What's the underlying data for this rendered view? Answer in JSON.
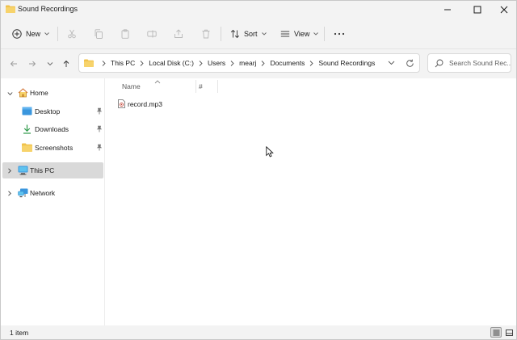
{
  "window": {
    "title": "Sound Recordings",
    "accent_color": "#0067c0",
    "folder_color": "#f0c24b"
  },
  "toolbar": {
    "new_label": "New",
    "sort_label": "Sort",
    "view_label": "View"
  },
  "address": {
    "crumbs": [
      "This PC",
      "Local Disk (C:)",
      "Users",
      "mearj",
      "Documents",
      "Sound Recordings"
    ]
  },
  "search": {
    "placeholder": "Search Sound Rec..."
  },
  "sidebar": {
    "items": [
      {
        "label": "Home",
        "icon": "home-icon",
        "expanded": true
      },
      {
        "label": "Desktop",
        "icon": "desktop-icon",
        "pinned": true
      },
      {
        "label": "Downloads",
        "icon": "downloads-icon",
        "pinned": true
      },
      {
        "label": "Screenshots",
        "icon": "folder-icon",
        "pinned": true
      },
      {
        "label": "This PC",
        "icon": "computer-icon",
        "selected": true
      },
      {
        "label": "Network",
        "icon": "network-icon"
      }
    ]
  },
  "content": {
    "columns": [
      "Name",
      "#"
    ],
    "files": [
      {
        "name": "record.mp3",
        "icon": "audio-file-icon"
      }
    ]
  },
  "status": {
    "item_count": "1 item"
  }
}
